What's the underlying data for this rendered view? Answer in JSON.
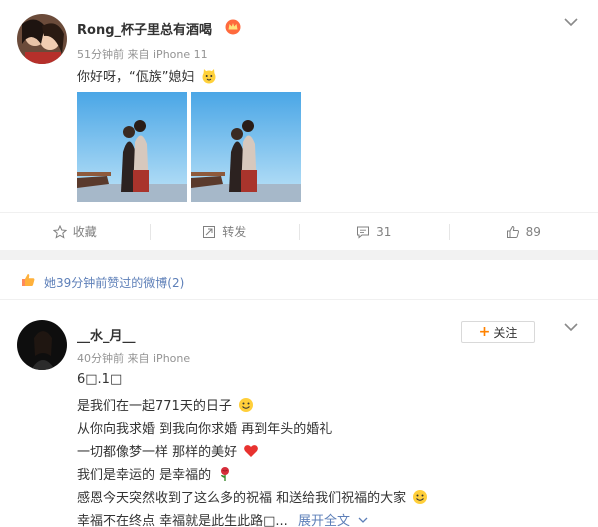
{
  "post1": {
    "username": "Rong_杯子里总有酒喝",
    "time": "51分钟前",
    "source_prefix": "来自",
    "source": "iPhone 11",
    "text": "你好呀，“佤族”媳妇",
    "emoji_icon": "cat-face-emoji-icon",
    "actions": {
      "favorite_label": "收藏",
      "repost_label": "转发",
      "comment_count": "31",
      "like_count": "89"
    }
  },
  "liked_bar": {
    "text": "她39分钟前赞过的微博(2)"
  },
  "post2": {
    "username": "__水_月__",
    "time": "40分钟前",
    "source_prefix": "来自",
    "source": "iPhone",
    "follow_label": "关注",
    "lines": [
      "6□.1□",
      "是我们在一起771天的日子",
      "从你向我求婚 到我向你求婚 再到年头的婚礼",
      "一切都像梦一样 那样的美好",
      "我们是幸运的 是幸福的",
      "感恩今天突然收到了这么多的祝福 和送给我们祝福的大家",
      "幸福不在终点 幸福就是此生此路□..."
    ],
    "expand_label": "展开全文"
  },
  "colors": {
    "link": "#5d7fb8",
    "accent": "#ff8200",
    "meta": "#939393"
  }
}
